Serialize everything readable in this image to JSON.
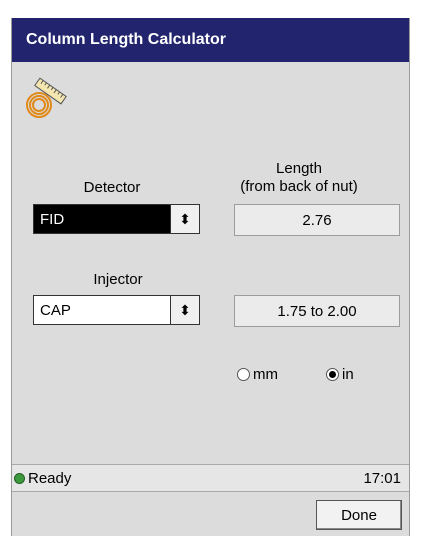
{
  "window": {
    "title": "Column Length Calculator"
  },
  "icon": {
    "name": "coiled-column-ruler-icon"
  },
  "labels": {
    "detector": "Detector",
    "injector": "Injector",
    "length_line1": "Length",
    "length_line2": "(from back of nut)"
  },
  "detector": {
    "value": "FID"
  },
  "injector": {
    "value": "CAP"
  },
  "results": {
    "detector_length": "2.76",
    "injector_length": "1.75 to 2.00"
  },
  "units": {
    "options": [
      {
        "label": "mm",
        "selected": false
      },
      {
        "label": "in",
        "selected": true
      }
    ]
  },
  "status": {
    "text": "Ready",
    "time": "17:01",
    "indicator_color": "#3c9a3c"
  },
  "buttons": {
    "done": "Done"
  },
  "colors": {
    "titlebar": "#22256e",
    "background": "#dcdcdc"
  }
}
